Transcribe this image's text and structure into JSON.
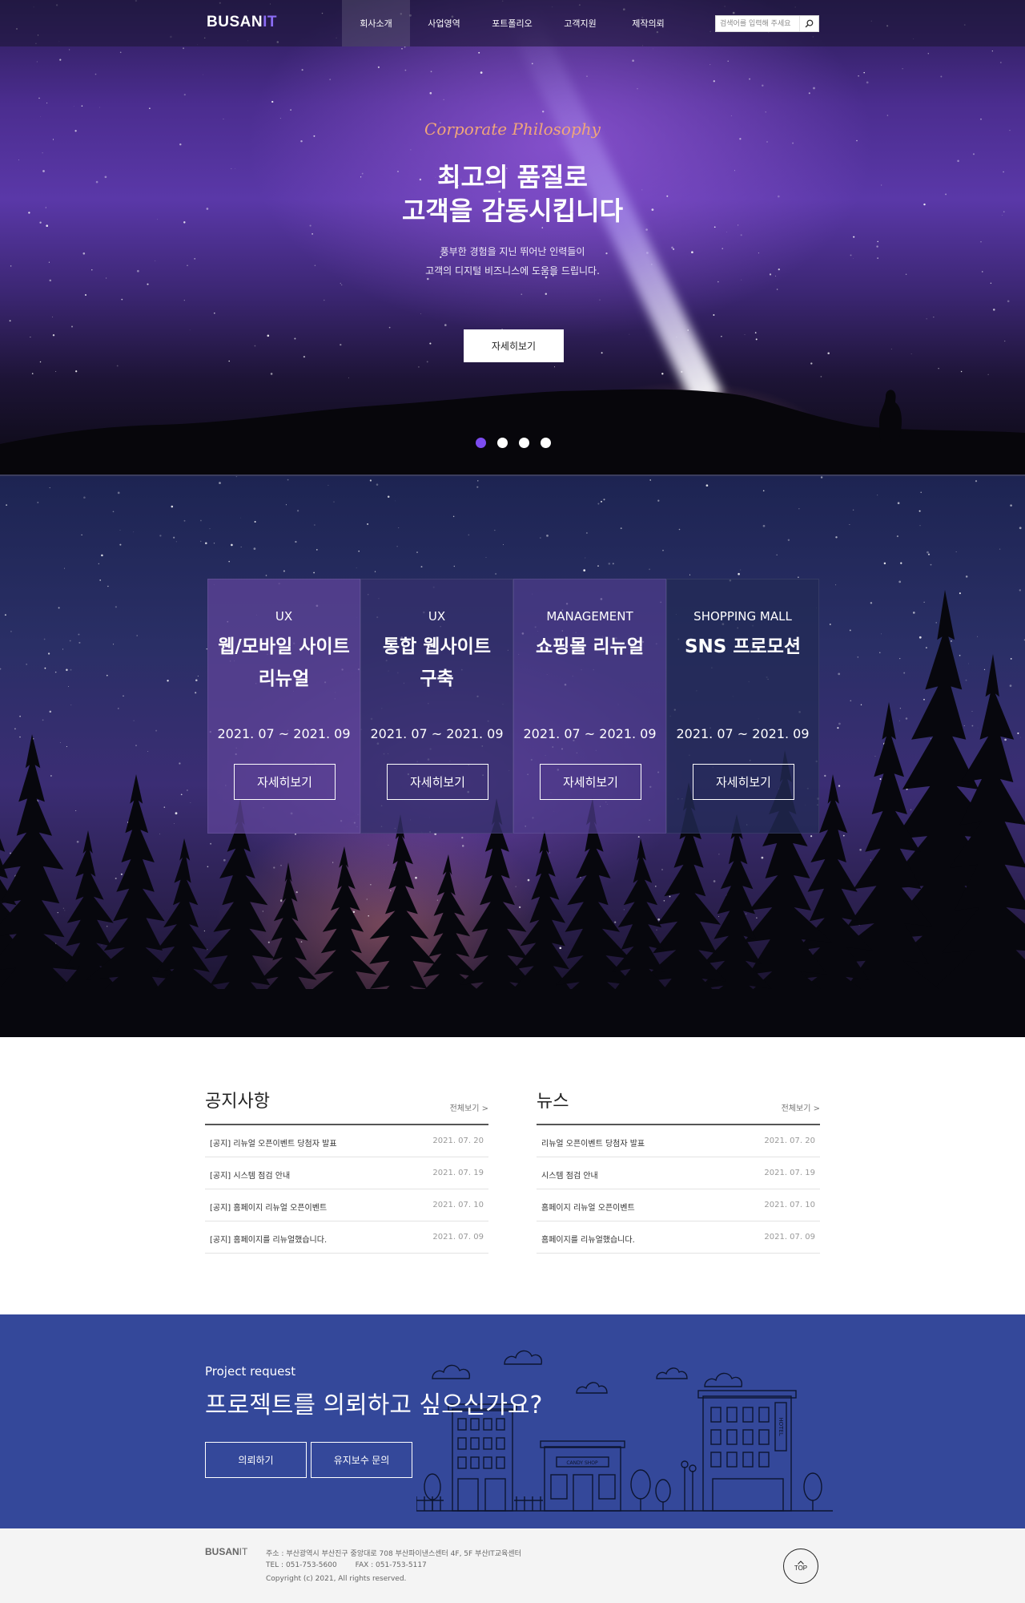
{
  "header": {
    "logo_main": "BUSAN",
    "logo_accent": "IT",
    "nav": [
      "회사소개",
      "사업영역",
      "포트폴리오",
      "고객지원",
      "제작의뢰"
    ],
    "active_nav_index": 0,
    "search_placeholder": "검색어를 입력해 주세요",
    "search_icon": "search-icon"
  },
  "hero": {
    "eyebrow": "Corporate Philosophy",
    "title_line1": "최고의 품질로",
    "title_line2": "고객을 감동시킵니다",
    "desc_line1": "풍부한 경험을 지닌 뛰어난 인력들이",
    "desc_line2": "고객의 디지털 비즈니스에 도움을 드립니다.",
    "button": "자세히보기",
    "slides_total": 4,
    "slide_active": 1,
    "colors": {
      "accent": "#7c4cf0",
      "eyebrow": "#f0a67a"
    }
  },
  "projects": [
    {
      "category": "UX",
      "title_line1": "웹/모바일 사이트",
      "title_line2": "리뉴얼",
      "date": "2021. 07 ~ 2021. 09",
      "button": "자세히보기"
    },
    {
      "category": "UX",
      "title_line1": "통합 웹사이트",
      "title_line2": "구축",
      "date": "2021. 07 ~ 2021. 09",
      "button": "자세히보기"
    },
    {
      "category": "MANAGEMENT",
      "title_line1": "쇼핑몰 리뉴얼",
      "title_line2": "",
      "date": "2021. 07 ~ 2021. 09",
      "button": "자세히보기"
    },
    {
      "category": "SHOPPING MALL",
      "title_line1": "SNS 프로모션",
      "title_line2": "",
      "date": "2021. 07 ~ 2021. 09",
      "button": "자세히보기"
    }
  ],
  "notice": {
    "title": "공지사항",
    "more": "전체보기 >",
    "rows": [
      {
        "title": "[공지] 리뉴얼 오픈이벤트 당첨자 발표",
        "date": "2021. 07. 20"
      },
      {
        "title": "[공지] 시스템 점검 안내",
        "date": "2021. 07. 19"
      },
      {
        "title": "[공지] 홈페이지 리뉴얼 오픈이벤트",
        "date": "2021. 07. 10"
      },
      {
        "title": "[공지] 홈페이지를 리뉴얼했습니다.",
        "date": "2021. 07. 09"
      }
    ]
  },
  "news": {
    "title": "뉴스",
    "more": "전체보기 >",
    "rows": [
      {
        "title": "리뉴얼 오픈이벤트 당첨자 발표",
        "date": "2021. 07. 20"
      },
      {
        "title": "시스템 점검 안내",
        "date": "2021. 07. 19"
      },
      {
        "title": "홈페이지 리뉴얼 오픈이벤트",
        "date": "2021. 07. 10"
      },
      {
        "title": "홈페이지를 리뉴얼했습니다.",
        "date": "2021. 07. 09"
      }
    ]
  },
  "request": {
    "small": "Project request",
    "title": "프로젝트를 의뢰하고 싶으신가요?",
    "btn_request": "의뢰하기",
    "btn_maintenance": "유지보수 문의",
    "sign_candy": "CANDY SHOP",
    "sign_hotel": "HOTEL",
    "bg_color": "#34489a"
  },
  "footer": {
    "logo_main": "BUSAN",
    "logo_accent": "IT",
    "address": "주소 : 부산광역시 부산진구 중앙대로 708 부산파이낸스센터 4F, 5F 부산IT교육센터",
    "tel": "TEL : 051-753-5600        FAX : 051-753-5117",
    "copyright": "Copyright (c) 2021, All rights reserved.",
    "top": "TOP"
  }
}
